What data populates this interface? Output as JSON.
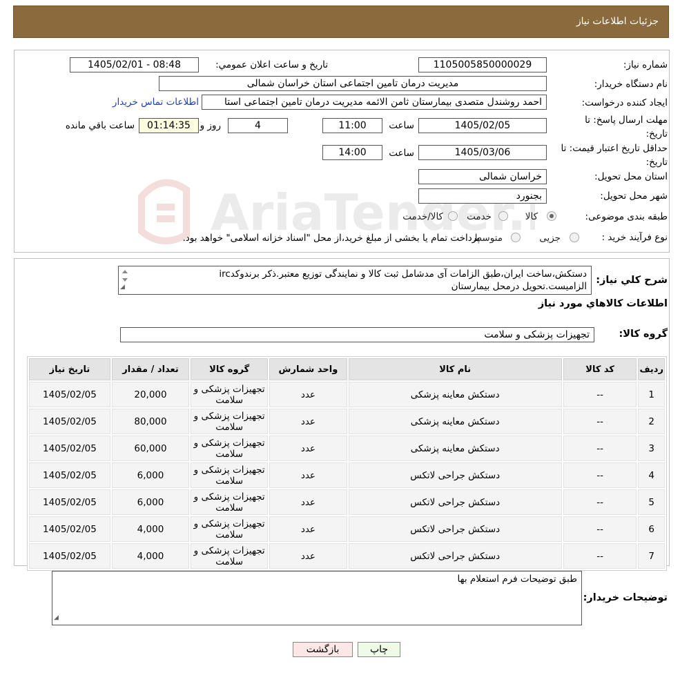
{
  "header": {
    "title": "جزئیات اطلاعات نیاز"
  },
  "watermark": {
    "text": "AriaTender.neT"
  },
  "fields": {
    "need_number_label": "شماره نیاز:",
    "need_number": "1105005850000029",
    "announce_label": "تاریخ و ساعت اعلان عمومي:",
    "announce_value": "1405/02/01 - 08:48",
    "buyer_org_label": "نام دستگاه خریدار:",
    "buyer_org": "مدیریت درمان تامین اجتماعی استان خراسان شمالی",
    "creator_label": "ایجاد کننده درخواست:",
    "creator": "احمد روشندل متصدی بیمارستان ثامن الائمه مدیریت درمان تامین اجتماعی استا",
    "contact_link": "اطلاعات تماس خریدار",
    "deadline_label": "مهلت ارسال پاسخ: تا تاریخ:",
    "deadline_date": "1405/02/05",
    "time_label": "ساعت",
    "deadline_time": "11:00",
    "days_value": "4",
    "days_label": "روز و",
    "remaining_value": "01:14:35",
    "remaining_label": "ساعت باقي مانده",
    "price_valid_label": "حداقل تاریخ اعتبار قیمت: تا تاریخ:",
    "price_valid_date": "1405/03/06",
    "price_valid_time": "14:00",
    "province_label": "استان محل تحویل:",
    "province": "خراسان شمالی",
    "city_label": "شهر محل تحویل:",
    "city": "بجنورد",
    "category_label": "طبقه بندی موضوعی:",
    "category_options": [
      "کالا",
      "خدمت",
      "کالا/خدمت"
    ],
    "process_label": "نوع فرآیند خرید :",
    "process_options": [
      "جزیی",
      "متوسط"
    ],
    "process_note": "پرداخت تمام یا بخشی از مبلغ خرید،از محل \"اسناد خزانه اسلامی\" خواهد بود."
  },
  "description": {
    "label": "شرح کلي نیاز:",
    "line1": "دستکش،ساخت ایران،طبق الزامات آی مدشامل ثبت کالا و نمایندگی توزیع معتبر.ذکر برندوکدirc",
    "line2": "الزامیست.تحویل درمحل بیمارستان"
  },
  "goods_section": {
    "title": "اطلاعات کالاهاي مورد نیاز",
    "group_label": "گروه کالا:",
    "group_value": "تجهیزات پزشکی و سلامت"
  },
  "table": {
    "headers": [
      "ردیف",
      "کد کالا",
      "نام کالا",
      "واحد شمارش",
      "گروه کالا",
      "تعداد / مقدار",
      "تاریخ نیاز"
    ],
    "rows": [
      {
        "row": "1",
        "code": "--",
        "name": "دستکش معاینه پزشکی",
        "unit": "عدد",
        "group": "تجهیزات پزشکی و سلامت",
        "qty": "20,000",
        "date": "1405/02/05"
      },
      {
        "row": "2",
        "code": "--",
        "name": "دستکش معاینه پزشکی",
        "unit": "عدد",
        "group": "تجهیزات پزشکی و سلامت",
        "qty": "80,000",
        "date": "1405/02/05"
      },
      {
        "row": "3",
        "code": "--",
        "name": "دستکش معاینه پزشکی",
        "unit": "عدد",
        "group": "تجهیزات پزشکی و سلامت",
        "qty": "60,000",
        "date": "1405/02/05"
      },
      {
        "row": "4",
        "code": "--",
        "name": "دستکش جراحی لاتکس",
        "unit": "عدد",
        "group": "تجهیزات پزشکی و سلامت",
        "qty": "6,000",
        "date": "1405/02/05"
      },
      {
        "row": "5",
        "code": "--",
        "name": "دستکش جراحی لاتکس",
        "unit": "عدد",
        "group": "تجهیزات پزشکی و سلامت",
        "qty": "6,000",
        "date": "1405/02/05"
      },
      {
        "row": "6",
        "code": "--",
        "name": "دستکش جراحی لاتکس",
        "unit": "عدد",
        "group": "تجهیزات پزشکی و سلامت",
        "qty": "4,000",
        "date": "1405/02/05"
      },
      {
        "row": "7",
        "code": "--",
        "name": "دستکش جراحی لاتکس",
        "unit": "عدد",
        "group": "تجهیزات پزشکی و سلامت",
        "qty": "4,000",
        "date": "1405/02/05"
      }
    ]
  },
  "buyer_notes": {
    "label": "توضیحات خریدار:",
    "value": "طبق توضیحات فرم استعلام بها"
  },
  "buttons": {
    "print": "چاپ",
    "back": "بازگشت"
  },
  "colors": {
    "header_bg": "#8b6b3d",
    "link": "#1a3fbf",
    "back_btn": "#fde6e6",
    "print_btn": "#eefbe6"
  }
}
